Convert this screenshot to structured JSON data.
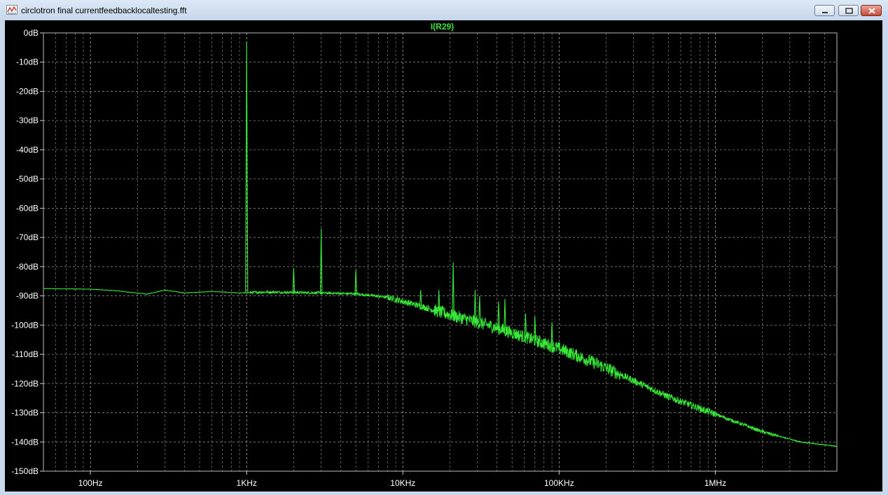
{
  "window": {
    "title": "circlotron final currentfeedbacklocaltesting.fft",
    "icon": "waveform-icon",
    "controls": [
      "minimize-icon",
      "maximize-icon",
      "close-icon"
    ]
  },
  "colors": {
    "background": "#000000",
    "grid": "#9a9a9a",
    "trace": "#38e838",
    "text": "#ffffff"
  },
  "chart_data": {
    "type": "line",
    "trace_name": "I(R29)",
    "xscale": "log",
    "xlim": [
      50,
      6000000
    ],
    "ylim": [
      -150,
      0
    ],
    "x_ticks": [
      {
        "value": 100,
        "label": "100Hz"
      },
      {
        "value": 1000,
        "label": "1KHz"
      },
      {
        "value": 10000,
        "label": "10KHz"
      },
      {
        "value": 100000,
        "label": "100KHz"
      },
      {
        "value": 1000000,
        "label": "1MHz"
      }
    ],
    "y_ticks": [
      {
        "value": 0,
        "label": "0dB"
      },
      {
        "value": -10,
        "label": "-10dB"
      },
      {
        "value": -20,
        "label": "-20dB"
      },
      {
        "value": -30,
        "label": "-30dB"
      },
      {
        "value": -40,
        "label": "-40dB"
      },
      {
        "value": -50,
        "label": "-50dB"
      },
      {
        "value": -60,
        "label": "-60dB"
      },
      {
        "value": -70,
        "label": "-70dB"
      },
      {
        "value": -80,
        "label": "-80dB"
      },
      {
        "value": -90,
        "label": "-90dB"
      },
      {
        "value": -100,
        "label": "-100dB"
      },
      {
        "value": -110,
        "label": "-110dB"
      },
      {
        "value": -120,
        "label": "-120dB"
      },
      {
        "value": -130,
        "label": "-130dB"
      },
      {
        "value": -140,
        "label": "-140dB"
      },
      {
        "value": -150,
        "label": "-150dB"
      }
    ],
    "grid": true,
    "noise_floor": [
      {
        "x": 50,
        "y": -87.5
      },
      {
        "x": 100,
        "y": -87.7
      },
      {
        "x": 150,
        "y": -88.3
      },
      {
        "x": 230,
        "y": -89.4
      },
      {
        "x": 300,
        "y": -88.0
      },
      {
        "x": 400,
        "y": -89.0
      },
      {
        "x": 600,
        "y": -88.5
      },
      {
        "x": 900,
        "y": -89.0
      },
      {
        "x": 1300,
        "y": -88.7
      },
      {
        "x": 2000,
        "y": -88.8
      },
      {
        "x": 3000,
        "y": -89.0
      },
      {
        "x": 5000,
        "y": -89.3
      },
      {
        "x": 8000,
        "y": -90.5
      },
      {
        "x": 12000,
        "y": -93.0
      },
      {
        "x": 20000,
        "y": -96.5
      },
      {
        "x": 35000,
        "y": -100.0
      },
      {
        "x": 60000,
        "y": -104.0
      },
      {
        "x": 100000,
        "y": -108.0
      },
      {
        "x": 170000,
        "y": -113.0
      },
      {
        "x": 300000,
        "y": -119.0
      },
      {
        "x": 500000,
        "y": -124.5
      },
      {
        "x": 1000000,
        "y": -130.5
      },
      {
        "x": 2000000,
        "y": -136.5
      },
      {
        "x": 3500000,
        "y": -140.0
      },
      {
        "x": 6000000,
        "y": -141.5
      }
    ],
    "spikes": [
      {
        "x": 1000,
        "y": -3
      },
      {
        "x": 2000,
        "y": -80.5
      },
      {
        "x": 3000,
        "y": -67
      },
      {
        "x": 5000,
        "y": -81
      },
      {
        "x": 13000,
        "y": -88
      },
      {
        "x": 17000,
        "y": -88
      },
      {
        "x": 21000,
        "y": -78.5
      },
      {
        "x": 29000,
        "y": -88
      },
      {
        "x": 31000,
        "y": -90
      },
      {
        "x": 41000,
        "y": -92
      },
      {
        "x": 45000,
        "y": -91
      },
      {
        "x": 61000,
        "y": -96
      },
      {
        "x": 70000,
        "y": -97
      },
      {
        "x": 90000,
        "y": -99
      }
    ]
  }
}
